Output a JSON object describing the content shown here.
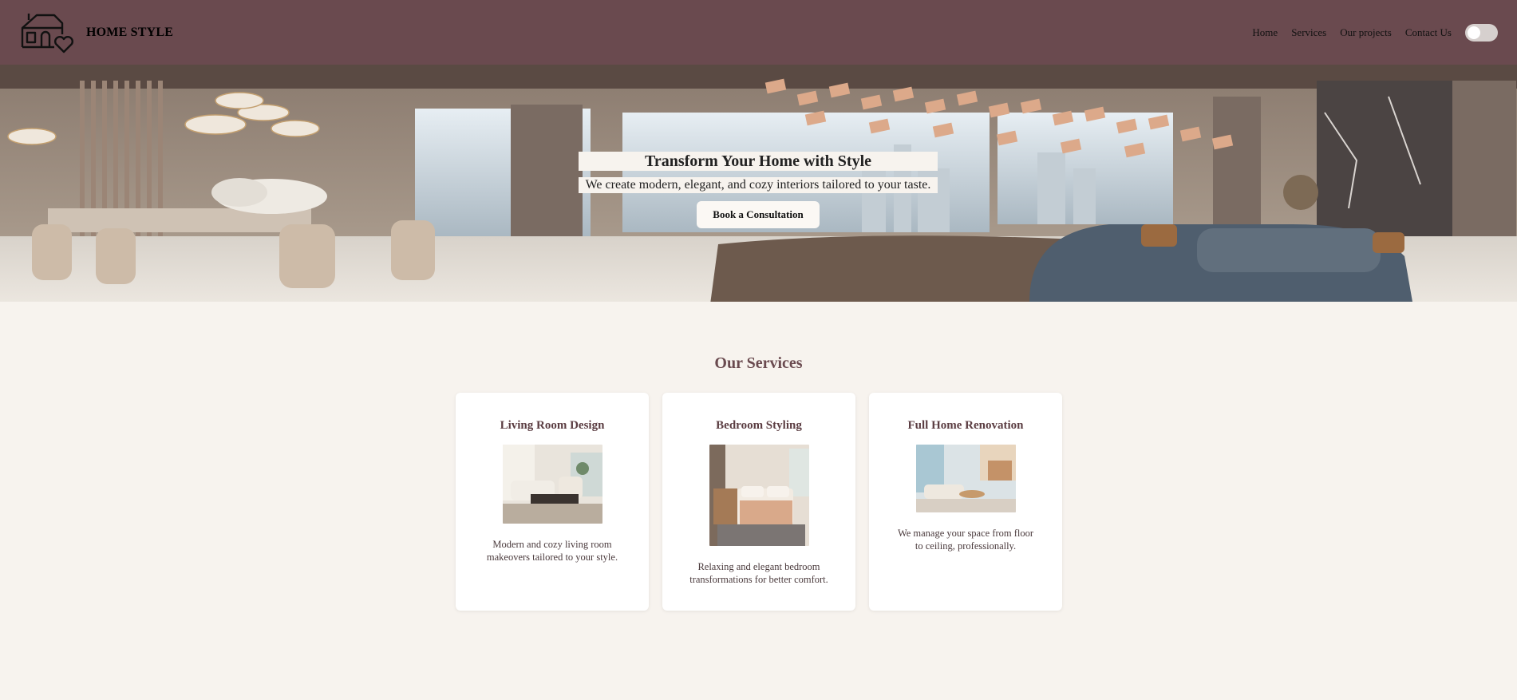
{
  "brand": {
    "name": "HOME STYLE"
  },
  "nav": {
    "items": [
      "Home",
      "Services",
      "Our projects",
      "Contact Us"
    ]
  },
  "hero": {
    "title": "Transform Your Home with Style",
    "subtitle": "We create modern, elegant, and cozy interiors tailored to your taste.",
    "cta": "Book a Consultation"
  },
  "services": {
    "heading": "Our Services",
    "cards": [
      {
        "title": "Living Room Design",
        "description": "Modern and cozy living room makeovers tailored to your style."
      },
      {
        "title": "Bedroom Styling",
        "description": "Relaxing and elegant bedroom transformations for better comfort."
      },
      {
        "title": "Full Home Renovation",
        "description": "We manage your space from floor to ceiling, professionally."
      }
    ]
  },
  "icons": {
    "logo": "house-heart-icon",
    "toggle": "theme-toggle"
  },
  "colors": {
    "header": "#6a4a4f",
    "page_bg": "#f7f3ee",
    "accent_text": "#6a4a4f"
  }
}
